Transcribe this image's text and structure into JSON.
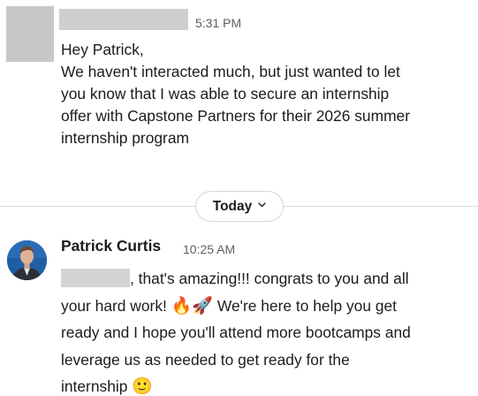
{
  "message1": {
    "time": "5:31 PM",
    "lines": [
      "Hey Patrick,",
      "We haven't interacted much, but just wanted to let",
      "you know that I was able to secure an internship",
      "offer with Capstone Partners for their 2026 summer",
      "internship program"
    ]
  },
  "divider": {
    "label": "Today",
    "chevron_icon": "chevron-down-icon"
  },
  "message2": {
    "sender": "Patrick Curtis",
    "time": "10:25 AM",
    "line1_after_mention": ", that's amazing!!! congrats to you and all",
    "line2_text": "your hard work!",
    "line2_emoji_fire": "🔥",
    "line2_emoji_rocket": "🚀",
    "line2_after": " We're here to help you get",
    "line3": "ready and I hope you'll attend more bootcamps and",
    "line4": "leverage us as needed to get ready for the",
    "line5_text": "internship",
    "line5_emoji": "🙂"
  }
}
